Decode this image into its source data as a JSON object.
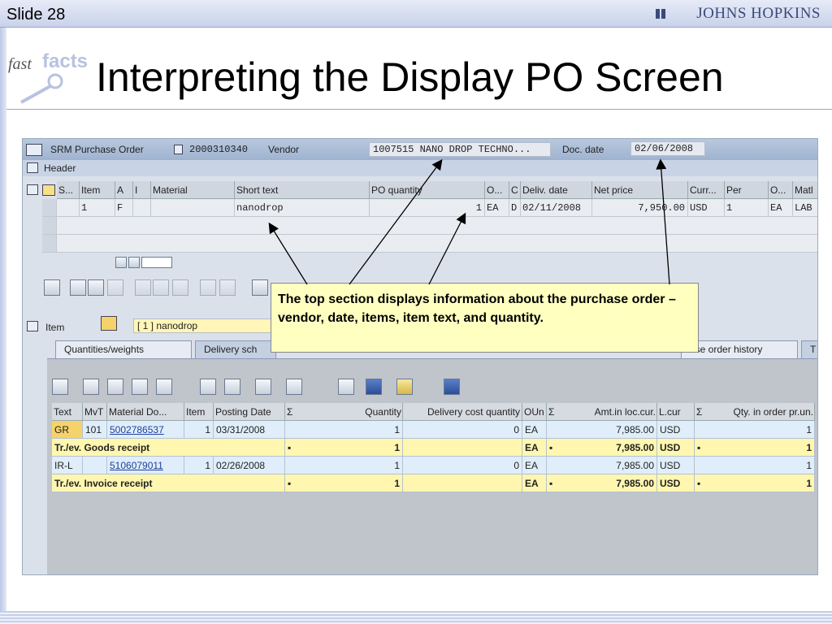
{
  "slide": {
    "number": "Slide 28",
    "brand": "JOHNS HOPKINS",
    "title": "Interpreting the Display PO Screen",
    "logo_fast": "fast",
    "logo_facts": "facts"
  },
  "po_header": {
    "doc_type": "SRM Purchase Order",
    "po_number": "2000310340",
    "vendor_label": "Vendor",
    "vendor_value": "1007515 NANO DROP TECHNO...",
    "doc_date_label": "Doc. date",
    "doc_date_value": "02/06/2008",
    "header_label": "Header"
  },
  "items_table": {
    "columns": [
      "S...",
      "Item",
      "A",
      "I",
      "Material",
      "Short text",
      "PO quantity",
      "O...",
      "C",
      "Deliv. date",
      "Net price",
      "Curr...",
      "Per",
      "O...",
      "Matl"
    ],
    "row": {
      "item": "1",
      "a": "F",
      "short_text": "nanodrop",
      "quantity": "1",
      "unit": "EA",
      "c": "D",
      "deliv_date": "02/11/2008",
      "net_price": "7,950.00",
      "currency": "USD",
      "per": "1",
      "order_unit": "EA",
      "matl": "LAB :"
    }
  },
  "item_row": {
    "label": "Item",
    "selected": "[ 1 ] nanodrop"
  },
  "tabs": [
    {
      "label": "Quantities/weights"
    },
    {
      "label": "Delivery sch"
    },
    {
      "label": "ase order history"
    },
    {
      "label": "T"
    }
  ],
  "history_table": {
    "columns": [
      "Text",
      "MvT",
      "Material Do...",
      "Item",
      "Posting Date",
      "Σ",
      "Quantity",
      "Delivery cost quantity",
      "OUn",
      "Σ",
      "Amt.in loc.cur.",
      "L.cur",
      "Σ",
      "Qty. in order pr.un."
    ],
    "rows": [
      {
        "text": "GR",
        "mvt": "101",
        "doc": "5002786537",
        "item": "1",
        "date": "03/31/2008",
        "qty": "1",
        "dcq": "0",
        "oun": "EA",
        "amt": "7,985.00",
        "cur": "USD",
        "qpu": "1"
      },
      {
        "text": "Tr./ev. Goods receipt",
        "qty": "1",
        "oun": "EA",
        "amt": "7,985.00",
        "cur": "USD",
        "qpu": "1",
        "dot": "▪"
      },
      {
        "text": "IR-L",
        "mvt": "",
        "doc": "5106079011",
        "item": "1",
        "date": "02/26/2008",
        "qty": "1",
        "dcq": "0",
        "oun": "EA",
        "amt": "7,985.00",
        "cur": "USD",
        "qpu": "1"
      },
      {
        "text": "Tr./ev. Invoice receipt",
        "qty": "1",
        "oun": "EA",
        "amt": "7,985.00",
        "cur": "USD",
        "qpu": "1",
        "dot": "▪"
      }
    ]
  },
  "callout": {
    "text": "The top section displays information about the purchase order – vendor, date, items, item text, and quantity."
  },
  "icons": [
    "cart-icon",
    "header-icon",
    "find-icon",
    "print-icon",
    "filter-icon",
    "info-icon",
    "refresh-icon"
  ]
}
